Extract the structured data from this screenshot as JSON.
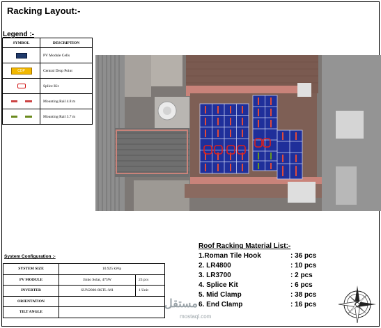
{
  "page": {
    "title": "Racking Layout:-"
  },
  "legend": {
    "title": "Legend :-",
    "headers": [
      "SYMBOL",
      "DESCRIPTION"
    ],
    "items": [
      {
        "symbol": "pv-cell-swatch",
        "description": "PV Module Cells",
        "color": "#1f3a6b"
      },
      {
        "symbol": "cdp-swatch",
        "symbol_text": "CDP",
        "description": "Central Drop Point",
        "color": "#f2b800"
      },
      {
        "symbol": "splice-kit-swatch",
        "description": "Splice Kit",
        "color": "#d01010"
      },
      {
        "symbol": "rail-red-swatch",
        "description": "Mounting Rail 4.8 m",
        "color": "#c44444"
      },
      {
        "symbol": "rail-green-swatch",
        "description": "Mounting Rail 3.7 m",
        "color": "#6a8a1e"
      }
    ]
  },
  "system_configuration": {
    "title": "System Configuration :-",
    "rows": [
      {
        "label": "SYSTEM SIZE",
        "value": "10.925  kWp",
        "unit": ""
      },
      {
        "label": "PV MODULE",
        "value": "Jinko Solar, 475W",
        "unit": "23 pcs"
      },
      {
        "label": "INVERTER",
        "value": "SUN2000-8KTL-M1",
        "unit": "1 Unit"
      },
      {
        "label": "ORIENTATION",
        "value": "",
        "unit": ""
      },
      {
        "label": "TILT ANGLE",
        "value": "",
        "unit": ""
      }
    ]
  },
  "materials": {
    "title": "Roof Racking Material List:-",
    "items": [
      {
        "name": "1.Roman Tile Hook",
        "qty": ": 36 pcs"
      },
      {
        "name": "2. LR4800",
        "qty": ": 10 pcs"
      },
      {
        "name": "3. LR3700",
        "qty": ": 2 pcs"
      },
      {
        "name": "4. Splice Kit",
        "qty": ": 6 pcs"
      },
      {
        "name": "5. Mid Clamp",
        "qty": ": 38 pcs"
      },
      {
        "name": "6. End Clamp",
        "qty": ": 16 pcs"
      }
    ]
  },
  "watermark": {
    "arabic": "مستقل",
    "latin": "mostaql.com"
  }
}
